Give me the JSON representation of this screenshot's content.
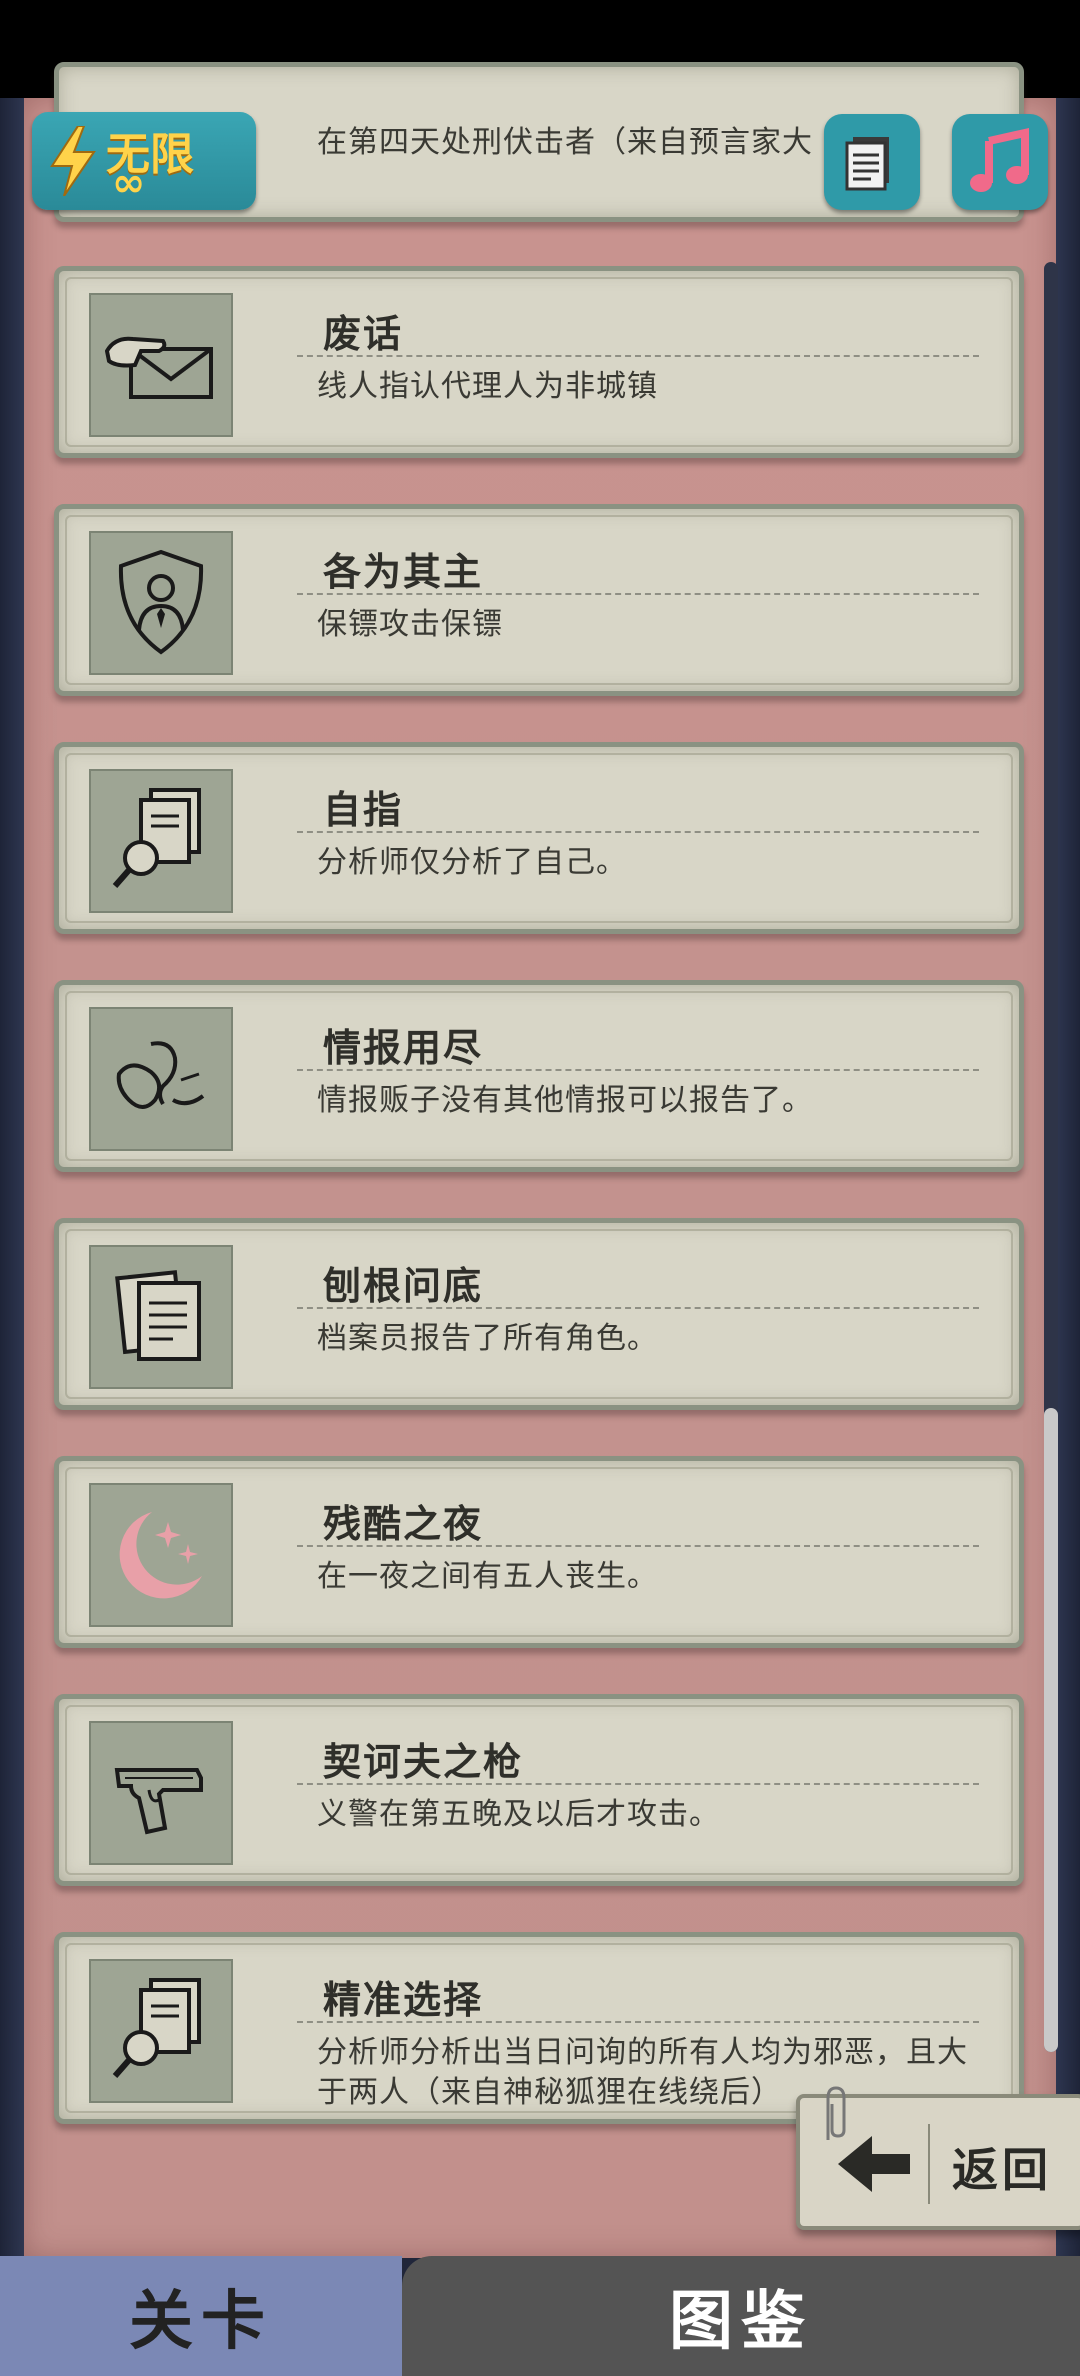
{
  "header": {
    "infinite_label": "无限",
    "infinite_symbol": "∞"
  },
  "partial_card": {
    "desc": "在第四天处刑伏击者（来自预言家大"
  },
  "cards": [
    {
      "icon": "hand-envelope-icon",
      "title": "废话",
      "desc": "线人指认代理人为非城镇"
    },
    {
      "icon": "shield-person-icon",
      "title": "各为其主",
      "desc": "保镖攻击保镖"
    },
    {
      "icon": "document-magnifier-icon",
      "title": "自指",
      "desc": "分析师仅分析了自己。"
    },
    {
      "icon": "whisper-icon",
      "title": "情报用尽",
      "desc": "情报贩子没有其他情报可以报告了。"
    },
    {
      "icon": "documents-icon",
      "title": "刨根问底",
      "desc": "档案员报告了所有角色。"
    },
    {
      "icon": "moon-stars-icon",
      "title": "残酷之夜",
      "desc": "在一夜之间有五人丧生。"
    },
    {
      "icon": "pistol-icon",
      "title": "契诃夫之枪",
      "desc": "义警在第五晚及以后才攻击。"
    },
    {
      "icon": "document-magnifier-icon",
      "title": "精准选择",
      "desc": "分析师分析出当日问询的所有人均为邪恶，且大于两人（来自神秘狐狸在线绕后）"
    }
  ],
  "back_button": {
    "label": "返回"
  },
  "tabs": {
    "levels": "关卡",
    "gallery": "图鉴"
  },
  "colors": {
    "paper": "#c9938f",
    "card": "#d8d6c7",
    "icon_box": "#9ea594",
    "badge": "#3aa6b4",
    "gold": "#ffd34a",
    "music": "#f06a8a",
    "tab_active": "#7b88b5",
    "tab_inactive": "#545454"
  }
}
